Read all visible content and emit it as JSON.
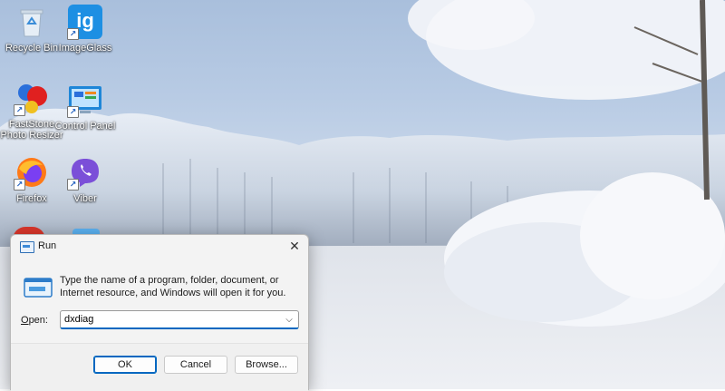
{
  "desktop": {
    "icons": [
      {
        "name": "recycle-bin",
        "label": "Recycle Bin",
        "icon": "recycle-bin-icon"
      },
      {
        "name": "imageglass",
        "label": "ImageGlass",
        "icon": "imageglass-icon",
        "glyph": "ig"
      },
      {
        "name": "faststone",
        "label": "FastStone\nPhoto Resizer",
        "icon": "faststone-icon"
      },
      {
        "name": "control-panel",
        "label": "Control Panel",
        "icon": "control-panel-icon"
      },
      {
        "name": "firefox",
        "label": "Firefox",
        "icon": "firefox-icon"
      },
      {
        "name": "viber",
        "label": "Viber",
        "icon": "viber-icon"
      }
    ]
  },
  "run_dialog": {
    "title": "Run",
    "close_glyph": "✕",
    "description": "Type the name of a program, folder, document, or Internet resource, and Windows will open it for you.",
    "open_label_prefix": "",
    "open_label_accel": "O",
    "open_label_rest": "pen:",
    "open_value": "dxdiag",
    "dropdown_glyph": "⌵",
    "ok_label": "OK",
    "cancel_label": "Cancel",
    "browse_label": "Browse...",
    "accent_color": "#0067c0"
  }
}
